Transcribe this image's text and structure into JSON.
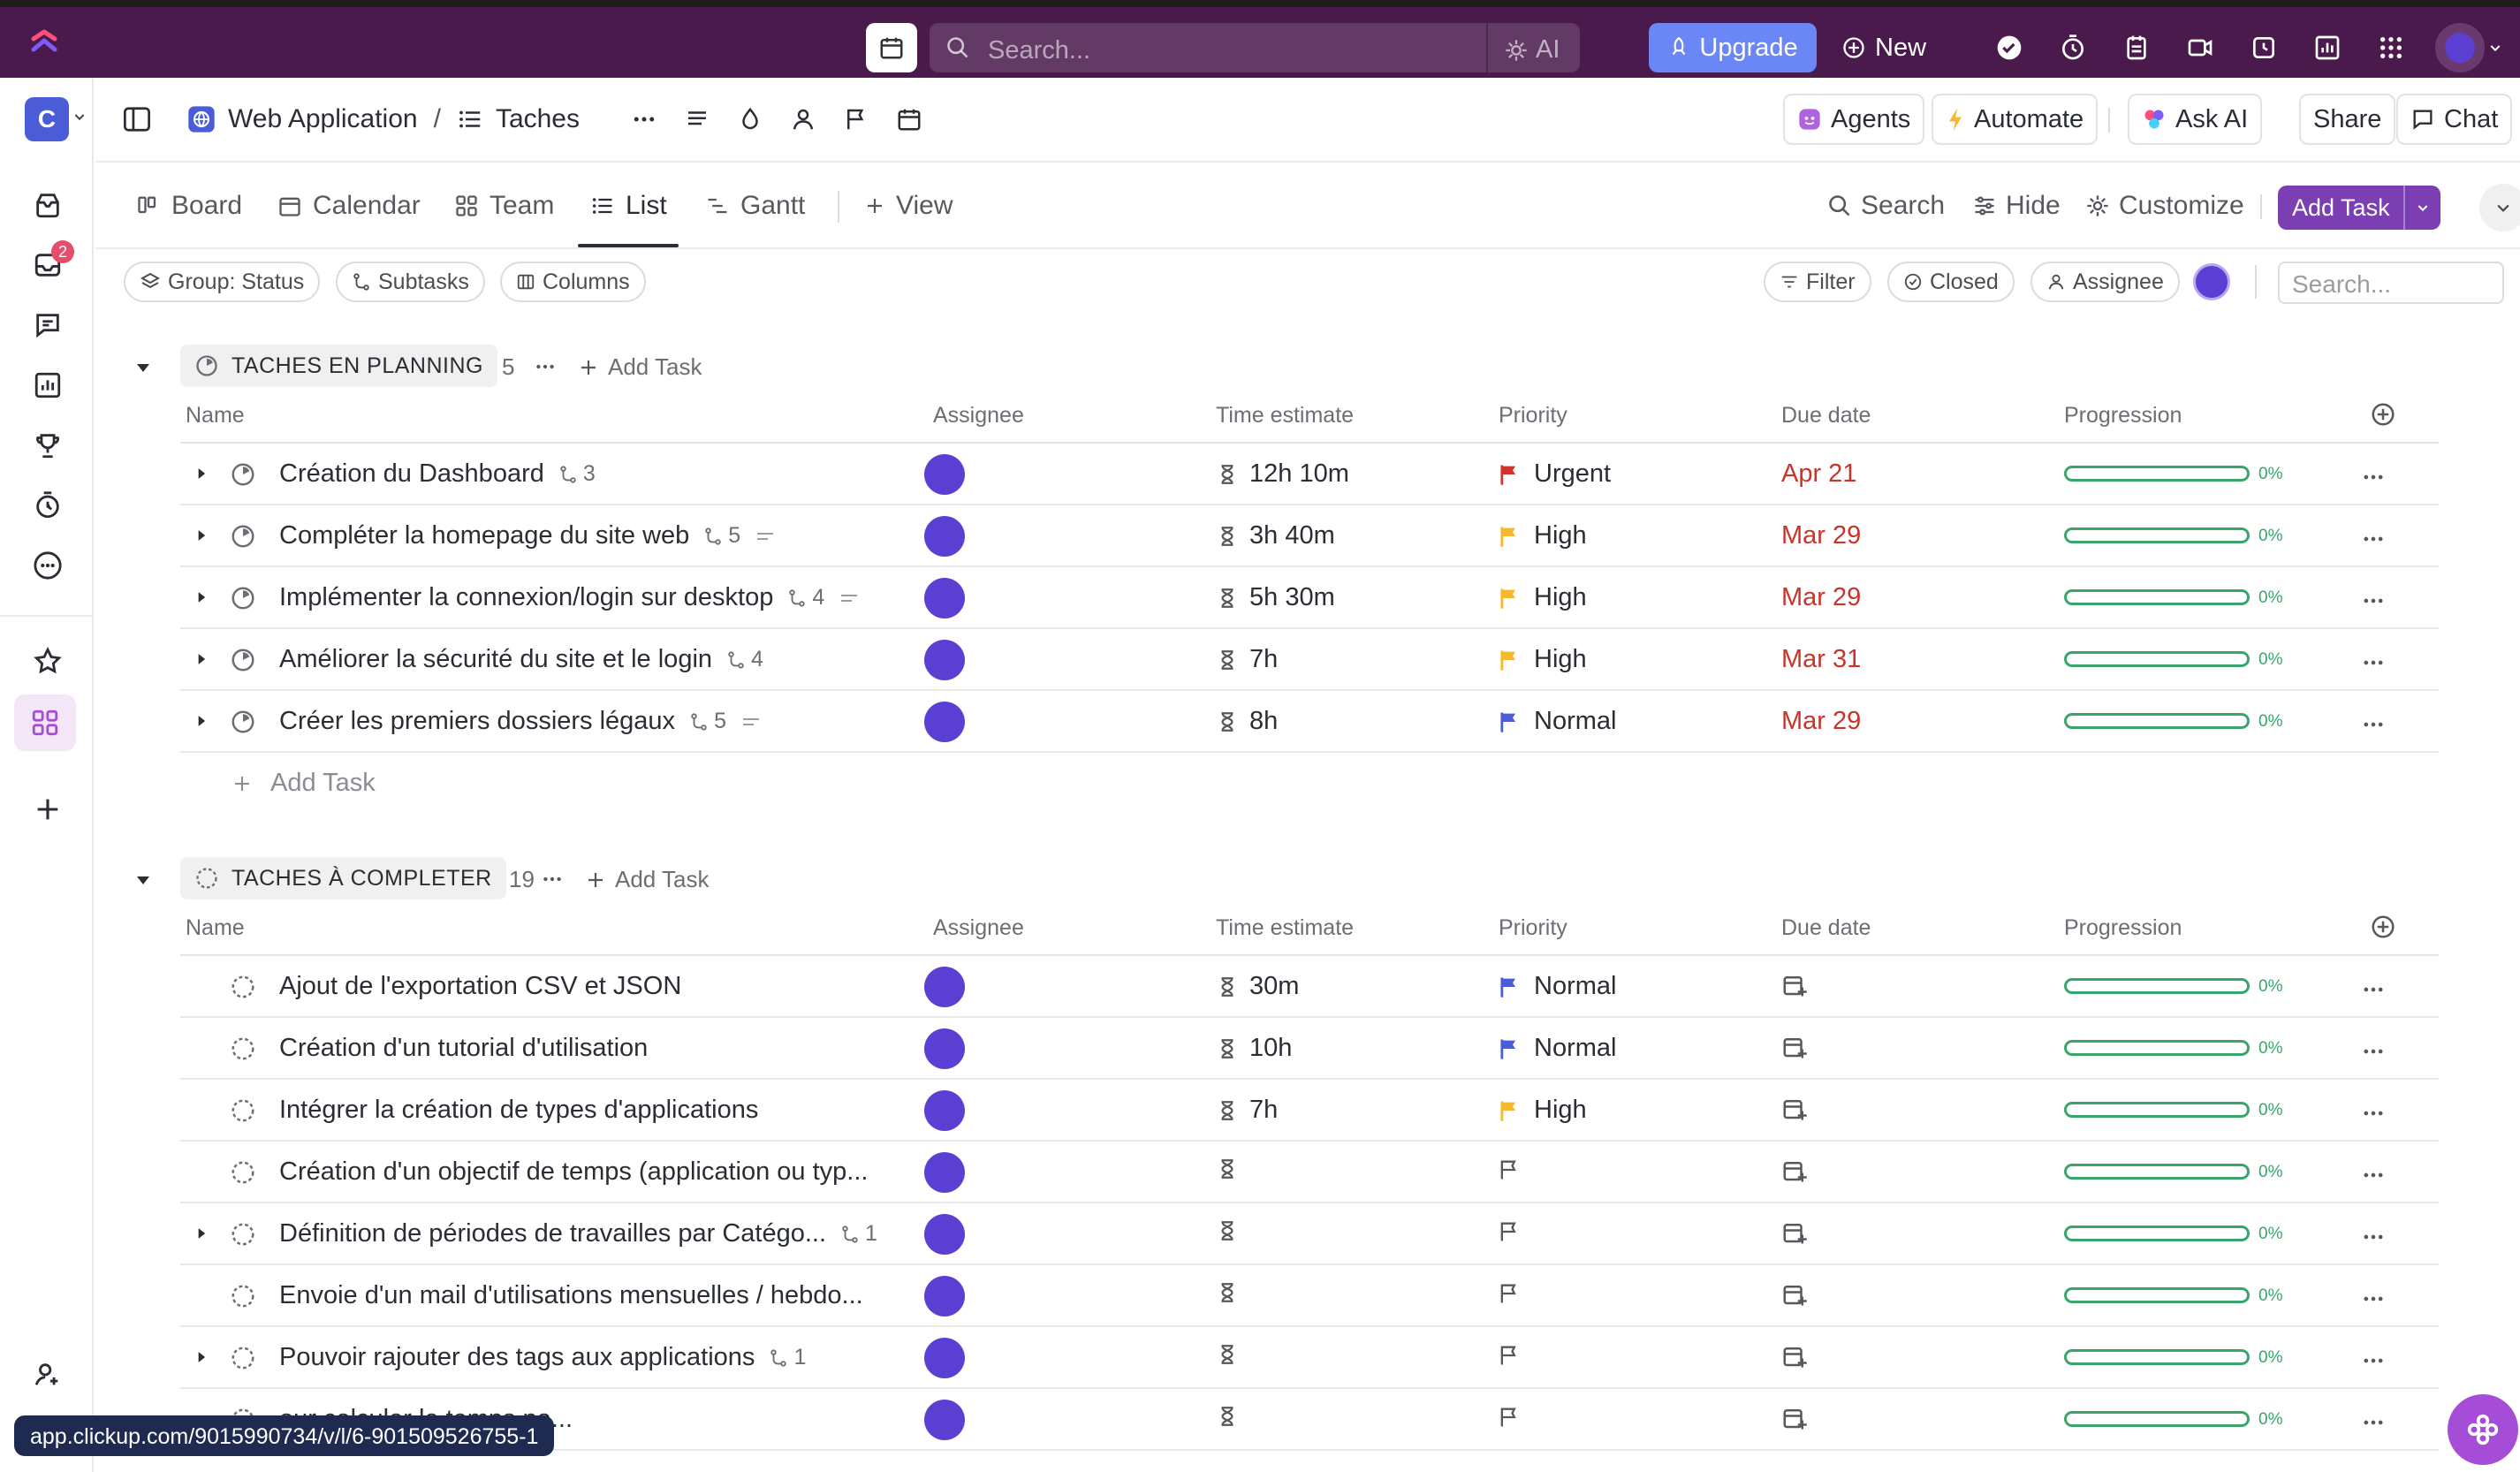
{
  "topbar": {
    "search_placeholder": "Search...",
    "ai_label": "AI",
    "upgrade_label": "Upgrade",
    "new_label": "New"
  },
  "workspace": {
    "initial": "C",
    "inbox_badge": "2"
  },
  "breadcrumb": {
    "space": "Web Application",
    "separator": "/",
    "list": "Taches"
  },
  "header_buttons": {
    "agents": "Agents",
    "automate": "Automate",
    "ask_ai": "Ask AI",
    "share": "Share",
    "chat": "Chat"
  },
  "views": {
    "tabs": [
      {
        "label": "Board",
        "icon": "board-icon"
      },
      {
        "label": "Calendar",
        "icon": "calendar-icon"
      },
      {
        "label": "Team",
        "icon": "team-icon"
      },
      {
        "label": "List",
        "icon": "list-icon",
        "active": true
      },
      {
        "label": "Gantt",
        "icon": "gantt-icon"
      }
    ],
    "add_view": "View",
    "search": "Search",
    "hide": "Hide",
    "customize": "Customize",
    "add_task": "Add Task"
  },
  "chips": {
    "group": "Group: Status",
    "subtasks": "Subtasks",
    "columns": "Columns",
    "filter": "Filter",
    "closed": "Closed",
    "assignee": "Assignee",
    "search_placeholder": "Search..."
  },
  "columns": {
    "name": "Name",
    "assignee": "Assignee",
    "time_estimate": "Time estimate",
    "priority": "Priority",
    "due_date": "Due date",
    "progression": "Progression"
  },
  "groups": [
    {
      "title": "TACHES EN PLANNING",
      "count": "5",
      "add_task": "Add Task",
      "tasks": [
        {
          "name": "Création du Dashboard",
          "subtasks": "3",
          "desc": false,
          "expand": true,
          "time": "12h 10m",
          "priority": "Urgent",
          "priority_color": "#d0342c",
          "due": "Apr 21",
          "progress": "0%"
        },
        {
          "name": "Compléter la homepage du site web",
          "subtasks": "5",
          "desc": true,
          "expand": true,
          "time": "3h 40m",
          "priority": "High",
          "priority_color": "#f5b82e",
          "due": "Mar 29",
          "progress": "0%"
        },
        {
          "name": "Implémenter la connexion/login sur desktop",
          "subtasks": "4",
          "desc": true,
          "expand": true,
          "time": "5h 30m",
          "priority": "High",
          "priority_color": "#f5b82e",
          "due": "Mar 29",
          "progress": "0%"
        },
        {
          "name": "Améliorer la sécurité du site et le login",
          "subtasks": "4",
          "desc": false,
          "expand": true,
          "time": "7h",
          "priority": "High",
          "priority_color": "#f5b82e",
          "due": "Mar 31",
          "progress": "0%"
        },
        {
          "name": "Créer les premiers dossiers légaux",
          "subtasks": "5",
          "desc": true,
          "expand": true,
          "time": "8h",
          "priority": "Normal",
          "priority_color": "#4a5cd8",
          "due": "Mar 29",
          "progress": "0%"
        }
      ],
      "add_row": "Add Task"
    },
    {
      "title": "TACHES À COMPLETER",
      "count": "19",
      "add_task": "Add Task",
      "tasks": [
        {
          "name": "Ajout de l'exportation CSV et JSON",
          "subtasks": "",
          "expand": false,
          "time": "30m",
          "priority": "Normal",
          "priority_color": "#4a5cd8",
          "due": "",
          "progress": "0%"
        },
        {
          "name": "Création d'un tutorial d'utilisation",
          "subtasks": "",
          "expand": false,
          "time": "10h",
          "priority": "Normal",
          "priority_color": "#4a5cd8",
          "due": "",
          "progress": "0%"
        },
        {
          "name": "Intégrer la création de types d'applications",
          "subtasks": "",
          "expand": false,
          "time": "7h",
          "priority": "High",
          "priority_color": "#f5b82e",
          "due": "",
          "progress": "0%"
        },
        {
          "name": "Création d'un objectif de temps (application ou typ...",
          "subtasks": "",
          "expand": false,
          "time": "",
          "priority": "",
          "priority_color": "",
          "due": "",
          "progress": "0%"
        },
        {
          "name": "Définition de périodes de travailles par Catégo...",
          "subtasks": "1",
          "expand": true,
          "time": "",
          "priority": "",
          "priority_color": "",
          "due": "",
          "progress": "0%"
        },
        {
          "name": "Envoie d'un mail d'utilisations mensuelles / hebdo...",
          "subtasks": "",
          "expand": false,
          "time": "",
          "priority": "",
          "priority_color": "",
          "due": "",
          "progress": "0%"
        },
        {
          "name": "Pouvoir rajouter des tags aux applications",
          "subtasks": "1",
          "expand": true,
          "time": "",
          "priority": "",
          "priority_color": "",
          "due": "",
          "progress": "0%"
        },
        {
          "name": "our calculer le temps pa...",
          "subtasks": "",
          "expand": false,
          "time": "",
          "priority": "",
          "priority_color": "",
          "due": "",
          "progress": "0%"
        }
      ]
    }
  ],
  "status_url": "app.clickup.com/9015990734/v/l/6-901509526755-1"
}
